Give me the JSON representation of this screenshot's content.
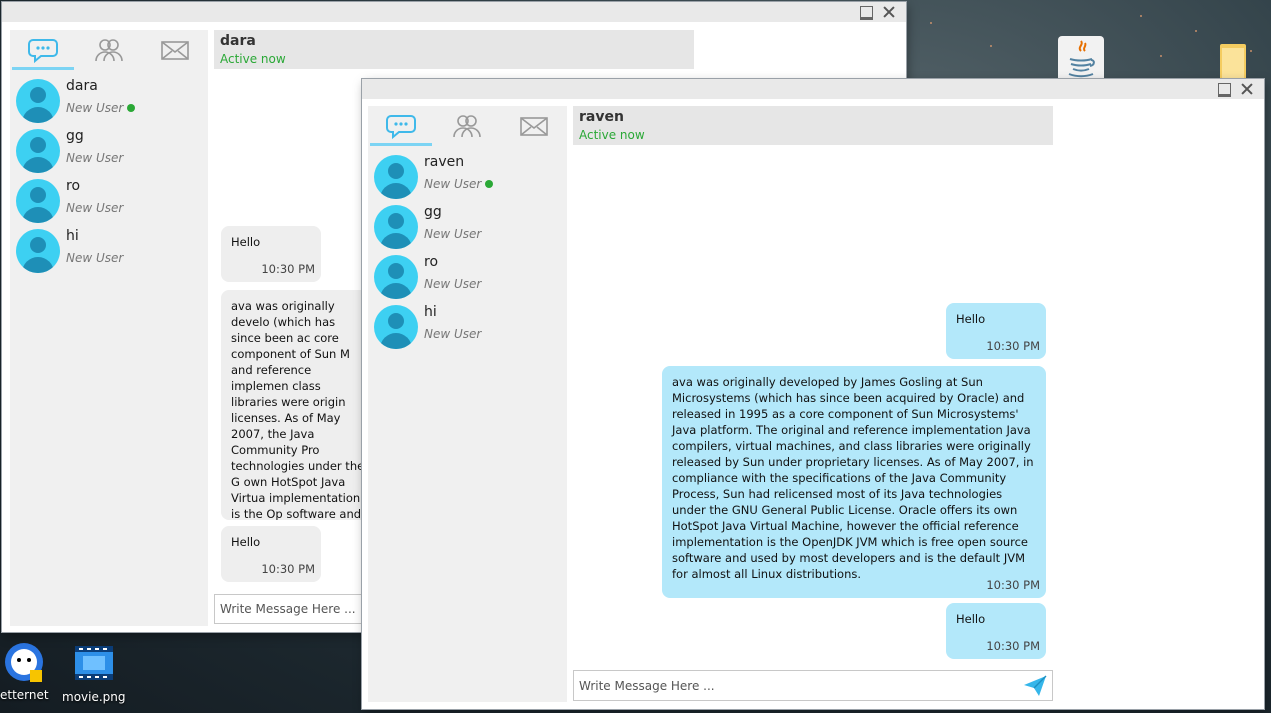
{
  "desktop": {
    "icons": [
      {
        "label": "etternet"
      },
      {
        "label": "movie.png"
      },
      {
        "label": ""
      },
      {
        "label": ""
      }
    ]
  },
  "back_window": {
    "chat": {
      "name": "dara",
      "status": "Active now"
    },
    "users": [
      {
        "name": "dara",
        "status": "New User",
        "online": true
      },
      {
        "name": "gg",
        "status": "New User",
        "online": false
      },
      {
        "name": "ro",
        "status": "New User",
        "online": false
      },
      {
        "name": "hi",
        "status": "New User",
        "online": false
      }
    ],
    "messages": [
      {
        "text": "Hello",
        "time": "10:30 PM"
      },
      {
        "text": "ava was originally develo (which has since been ac core component of Sun M and reference implemen class libraries were origin licenses. As of May 2007, the Java Community Pro technologies under the G own HotSpot Java Virtua implementation is the Op software and used by mo almost all Linux distribut",
        "time": ""
      },
      {
        "text": "Hello",
        "time": "10:30 PM"
      }
    ],
    "input_placeholder": "Write Message Here ..."
  },
  "front_window": {
    "chat": {
      "name": "raven",
      "status": "Active now"
    },
    "users": [
      {
        "name": "raven",
        "status": "New User",
        "online": true
      },
      {
        "name": "gg",
        "status": "New User",
        "online": false
      },
      {
        "name": "ro",
        "status": "New User",
        "online": false
      },
      {
        "name": "hi",
        "status": "New User",
        "online": false
      }
    ],
    "messages": [
      {
        "text": "Hello",
        "time": "10:30 PM"
      },
      {
        "text": "ava was originally developed by James Gosling at Sun Microsystems (which has since been acquired by Oracle) and released in 1995 as a core component of Sun Microsystems' Java platform. The original and reference implementation Java compilers, virtual machines, and class libraries were originally released by Sun under proprietary licenses. As of May 2007, in compliance with the specifications of the Java Community Process, Sun had relicensed most of its Java technologies under the GNU General Public License. Oracle offers its own HotSpot Java Virtual Machine, however the official reference implementation is the OpenJDK JVM which is free open source software and used by most developers and is the default JVM for almost all Linux distributions.",
        "time": "10:30 PM"
      },
      {
        "text": "Hello",
        "time": "10:30 PM"
      }
    ],
    "input_placeholder": "Write Message Here ..."
  },
  "colors": {
    "accent": "#7cd4f4",
    "online": "#2aa836",
    "outgoing_bubble": "#b3e8fa",
    "incoming_bubble": "#eeeeee",
    "avatar": "#3dd0f2"
  }
}
